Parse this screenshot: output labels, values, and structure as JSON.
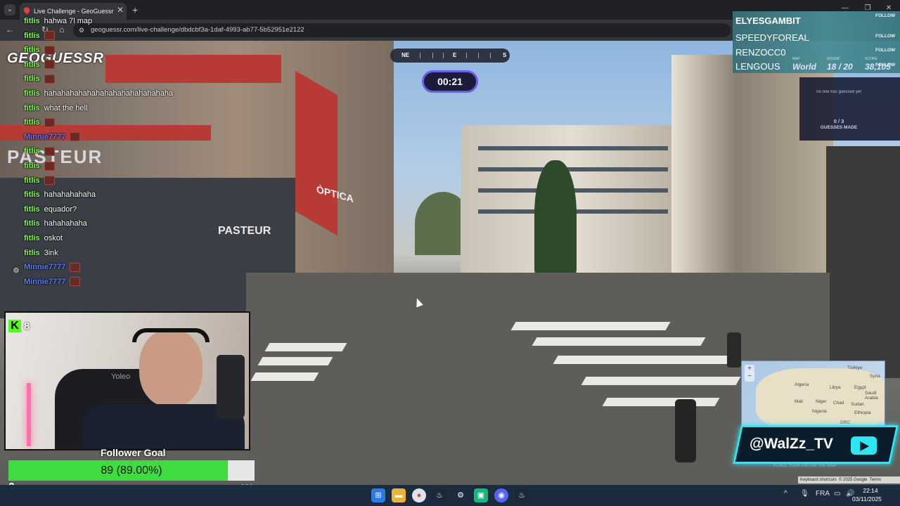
{
  "browser": {
    "tab_title": "Live Challenge - GeoGuessr",
    "tab_close": "✕",
    "new_tab": "+",
    "url": "geoguessr.com/live-challenge/dbdcbf3a-1daf-4993-ab77-5b52951e2122",
    "window_controls": [
      "—",
      "❐",
      "✕"
    ]
  },
  "game": {
    "logo": "GEOGUESSR",
    "compass": {
      "left": "NE",
      "center": "E",
      "right": "S"
    },
    "timer": "00:21",
    "guesses_none": "no one has guessed yet",
    "guesses_count": "0 / 3",
    "guesses_label": "GUESSES MADE",
    "place_pin": "PLACE YOUR PIN ON THE MAP",
    "map_zoom": [
      "+",
      "−"
    ],
    "map_labels": [
      "Türkiye",
      "Syria",
      "Algeria",
      "Libya",
      "Egypt",
      "Saudi Arabia",
      "Mali",
      "Niger",
      "Chad",
      "Sudan",
      "Nigeria",
      "Ethiopia",
      "DRC"
    ],
    "gmaps_bar": [
      "Keyboard shortcuts",
      "© 2025 Google",
      "Terms"
    ]
  },
  "leaderboard": {
    "rows": [
      {
        "name": "ELYESGAMBIT",
        "follow": "FOLLOW"
      },
      {
        "name": "SPEEDYFOREAL",
        "follow": "FOLLOW"
      },
      {
        "name": "RENZOCC0",
        "follow": "FOLLOW"
      },
      {
        "name": "LENGOUS",
        "follow": "FOLLOW"
      }
    ],
    "map_label": "MAP",
    "map_value": "World",
    "round_label": "ROUND",
    "round_value": "18 / 20",
    "score_label": "SCORE",
    "score_value": "38,105"
  },
  "chat": [
    {
      "user": "fitlis",
      "msg": "hahwa 7l map"
    },
    {
      "user": "fitlis",
      "msg": ""
    },
    {
      "user": "fitlis",
      "msg": ""
    },
    {
      "user": "fitlis",
      "msg": ""
    },
    {
      "user": "fitlis",
      "msg": ""
    },
    {
      "user": "fitlis",
      "msg": "hahahahahahahahahahahahahahaha"
    },
    {
      "user": "fitlis",
      "msg": "what the hell"
    },
    {
      "user": "fitlis",
      "msg": ""
    },
    {
      "user": "Minnie7777",
      "msg": ""
    },
    {
      "user": "fitlis",
      "msg": ""
    },
    {
      "user": "fitlis",
      "msg": ""
    },
    {
      "user": "fitlis",
      "msg": ""
    },
    {
      "user": "fitlis",
      "msg": "hahahahahaha"
    },
    {
      "user": "fitlis",
      "msg": "equador?"
    },
    {
      "user": "fitlis",
      "msg": "hahahahaha"
    },
    {
      "user": "fitlis",
      "msg": "oskot"
    },
    {
      "user": "fitlis",
      "msg": "3ink"
    },
    {
      "user": "Minnie7777",
      "msg": ""
    },
    {
      "user": "Minnie7777",
      "msg": ""
    }
  ],
  "scene_signs": {
    "shop1": "PASTEUR",
    "shop2": "PASTEUR",
    "shop3": "ÒPTICA"
  },
  "webcam": {
    "viewer_count": "8",
    "kick_logo": "K",
    "chair_brand": "Yoleo"
  },
  "follower_goal": {
    "title": "Follower Goal",
    "text": "89 (89.00%)",
    "progress": 0.89,
    "min": "0",
    "max": "100"
  },
  "social": {
    "handle": "@WalZz_TV"
  },
  "taskbar": {
    "apps": [
      "windows-start",
      "file-explorer",
      "chrome",
      "steam",
      "settings",
      "terminal",
      "discord",
      "steam-2"
    ],
    "tray_lang": "FRA",
    "time": "22:14",
    "date": "03/11/2025"
  },
  "colors": {
    "accent": "#6c5ce7",
    "kick_green": "#53fc18",
    "cyan": "#2ee6f0",
    "goal_fill": "#3fdc3f"
  }
}
